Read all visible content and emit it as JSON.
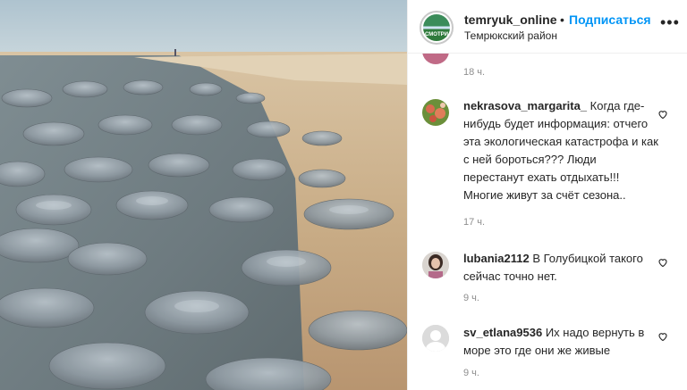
{
  "post": {
    "username": "temryuk_online",
    "separator": "•",
    "follow_label": "Подписаться",
    "location": "Темрюкский район",
    "avatar_text": "СМОТРИ",
    "more_icon": "more-horizontal-icon"
  },
  "comments": [
    {
      "username": "",
      "text": "",
      "time": "18 ч."
    },
    {
      "username": "nekrasova_margarita_",
      "text": "Когда где-нибудь будет информация: отчего эта экологическая катастрофа и как с ней бороться??? Люди перестанут ехать отдыхать!!! Многие живут за счёт сезона..",
      "time": "17 ч."
    },
    {
      "username": "lubania2112",
      "text": "В Голубицкой такого сейчас точно нет.",
      "time": "9 ч."
    },
    {
      "username": "sv_etlana9536",
      "text": "Их надо вернуть в море это где они же живые",
      "time": "9 ч."
    }
  ],
  "colors": {
    "follow": "#0095f6",
    "text": "#262626",
    "muted": "#8e8e8e",
    "border": "#efefef"
  }
}
